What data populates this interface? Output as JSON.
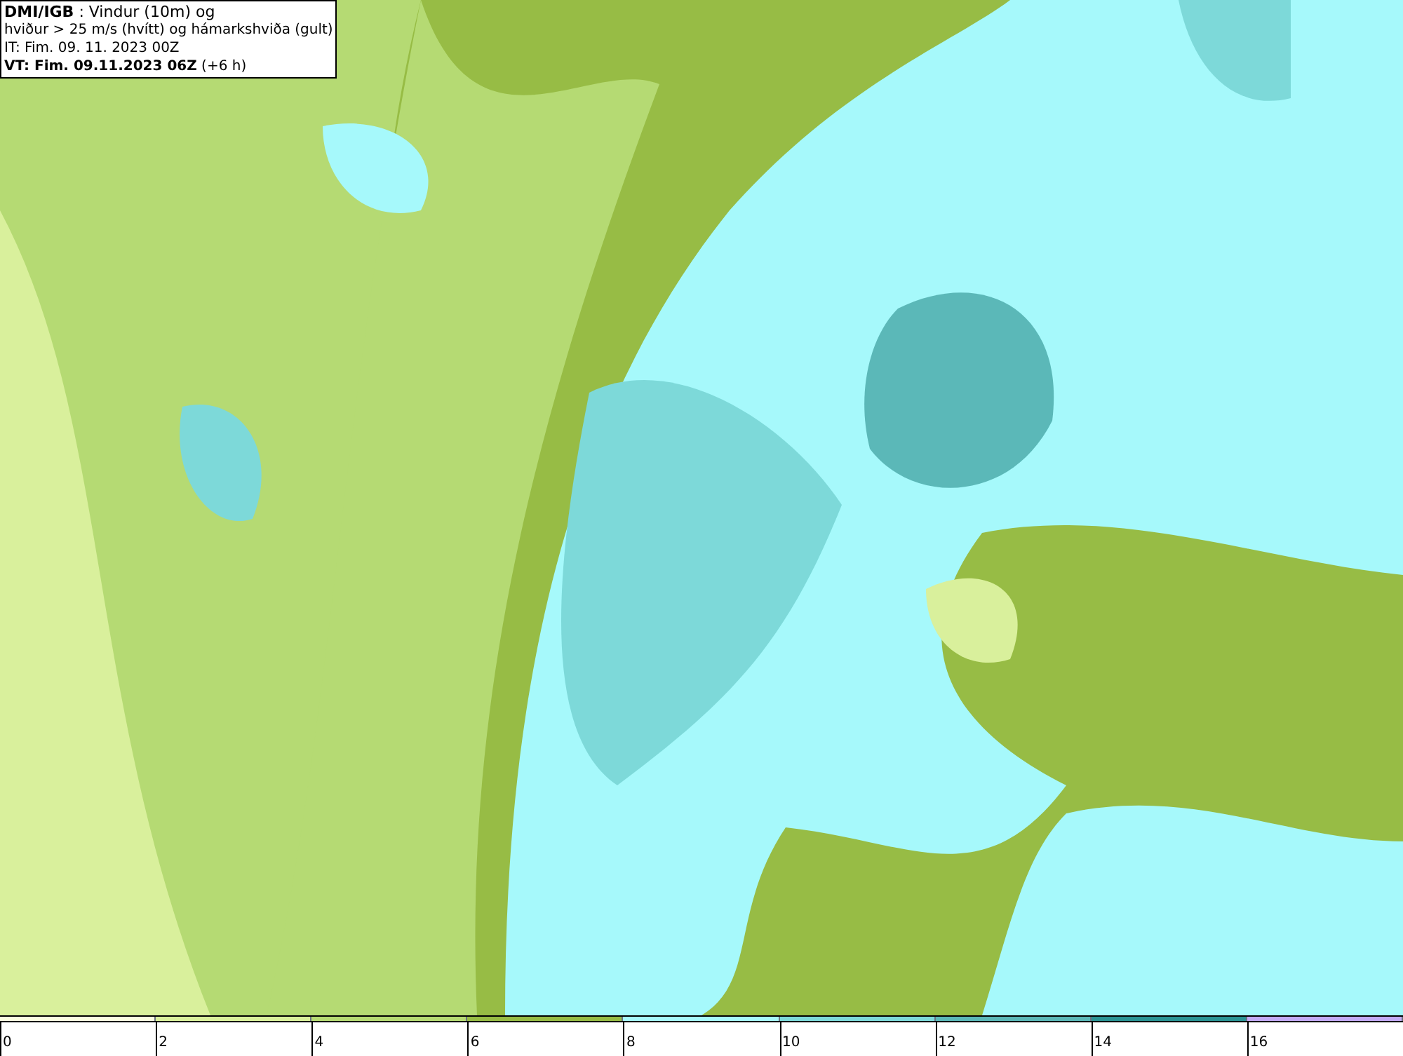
{
  "title_box": {
    "lines": [
      "**DMI/IGB** : Vindur (10m) og",
      "hviður > 25 m/s (hvítt) og hámarkshviða (gult)",
      "IT: Fim. 09. 11. 2023 00Z",
      "**VT: Fim. 09.11.2023 06Z** (+6 h)"
    ]
  },
  "legend": {
    "items": [
      {
        "label": "0",
        "color": "#fafde0"
      },
      {
        "label": "2",
        "color": "#d9f09c"
      },
      {
        "label": "4",
        "color": "#b5da73"
      },
      {
        "label": "6",
        "color": "#97bc45"
      },
      {
        "label": "8",
        "color": "#a6f9fb"
      },
      {
        "label": "10",
        "color": "#7dd9d9"
      },
      {
        "label": "12",
        "color": "#5bb8b8"
      },
      {
        "label": "14",
        "color": "#2a9494"
      },
      {
        "label": "16",
        "color": "#c3aaf5"
      }
    ]
  }
}
